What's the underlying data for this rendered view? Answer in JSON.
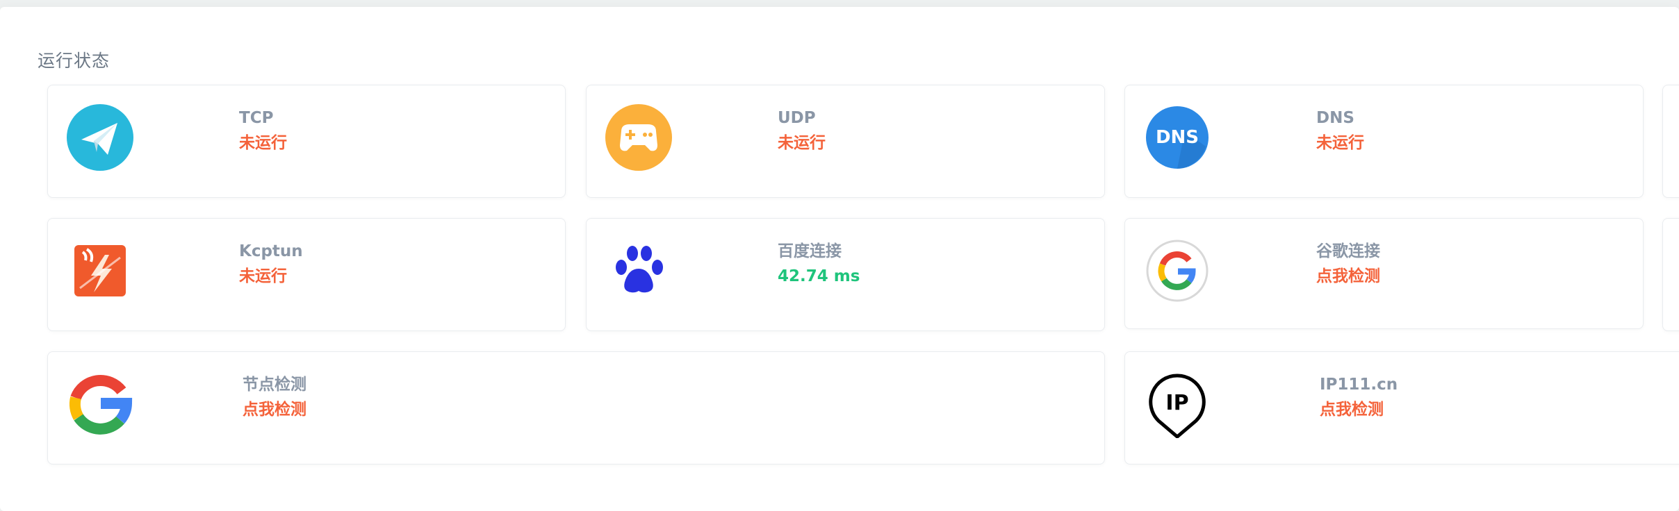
{
  "panel": {
    "title": "运行状态"
  },
  "colors": {
    "danger": "#f4623a",
    "success": "#1fc47c",
    "label": "#8a96a6"
  },
  "cards": [
    {
      "name": "TCP",
      "status": "未运行",
      "status_type": "danger",
      "icon": "paper-plane-icon"
    },
    {
      "name": "UDP",
      "status": "未运行",
      "status_type": "danger",
      "icon": "gamepad-icon"
    },
    {
      "name": "DNS",
      "status": "未运行",
      "status_type": "danger",
      "icon": "dns-icon",
      "icon_text": "DNS"
    },
    {
      "name": "Kcptun",
      "status": "未运行",
      "status_type": "danger",
      "icon": "kcptun-icon"
    },
    {
      "name": "百度连接",
      "status": "42.74 ms",
      "status_type": "success",
      "icon": "baidu-paw-icon"
    },
    {
      "name": "谷歌连接",
      "status": "点我检测",
      "status_type": "danger",
      "icon": "google-icon"
    },
    {
      "name": "节点检测",
      "status": "点我检测",
      "status_type": "danger",
      "icon": "google-g-icon"
    },
    {
      "name": "IP111.cn",
      "status": "点我检测",
      "status_type": "danger",
      "icon": "ip-pin-icon",
      "icon_text": "IP"
    }
  ]
}
